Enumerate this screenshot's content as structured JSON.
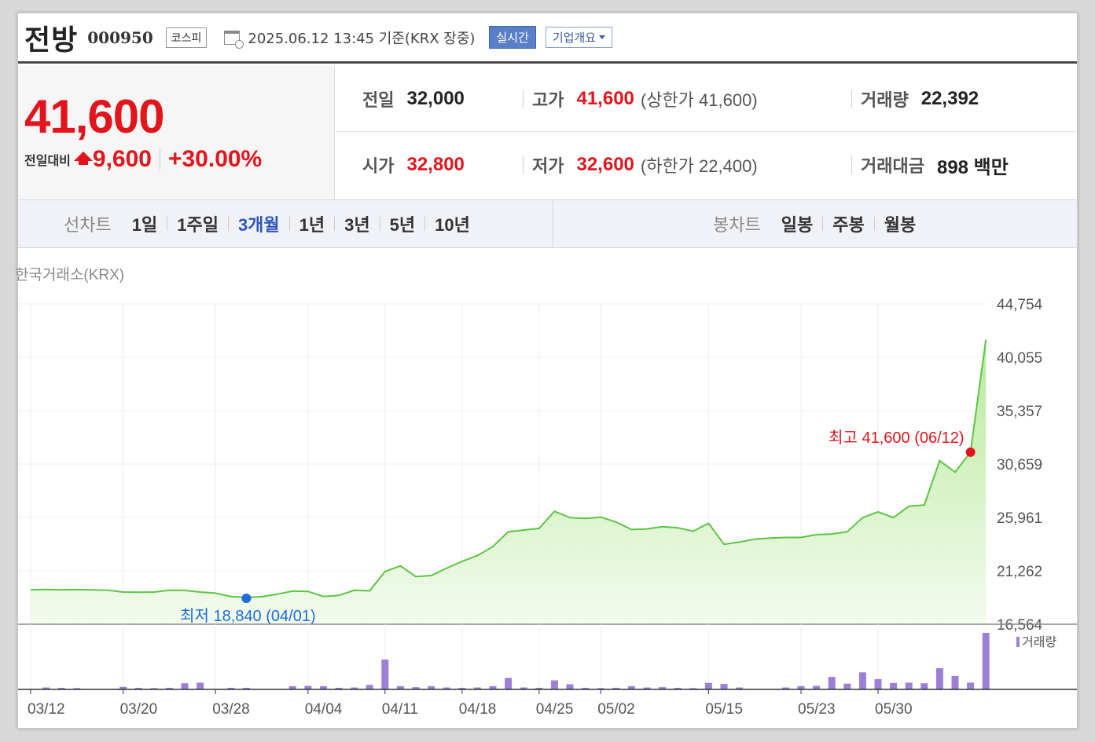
{
  "header": {
    "name": "전방",
    "code": "000950",
    "market": "코스피",
    "timestamp": "2025.06.12 13:45  기준(KRX 장중)",
    "realtime_label": "실시간",
    "company_label": "기업개요"
  },
  "price": {
    "current": "41,600",
    "change_label": "전일대비",
    "change": "9,600",
    "change_pct": "+30.00%"
  },
  "stats": {
    "prev_label": "전일",
    "prev": "32,000",
    "high_label": "고가",
    "high": "41,600",
    "high_note": "(상한가 41,600)",
    "volume_label": "거래량",
    "volume": "22,392",
    "open_label": "시가",
    "open": "32,800",
    "low_label": "저가",
    "low": "32,600",
    "low_note": "(하한가 22,400)",
    "amount_label": "거래대금",
    "amount": "898 백만"
  },
  "period": {
    "line_label": "선차트",
    "line_items": [
      "1일",
      "1주일",
      "3개월",
      "1년",
      "3년",
      "5년",
      "10년"
    ],
    "selected": "3개월",
    "candle_label": "봉차트",
    "candle_items": [
      "일봉",
      "주봉",
      "월봉"
    ]
  },
  "chart_data": {
    "type": "area",
    "source": "한국거래소(KRX)",
    "y_ticks": [
      "44,754",
      "40,055",
      "35,357",
      "30,659",
      "25,961",
      "21,262",
      "16,564"
    ],
    "y_tick_values": [
      44754,
      40055,
      35357,
      30659,
      25961,
      21262,
      16564
    ],
    "ylim": [
      16564,
      44754
    ],
    "x_ticks": [
      "03/12",
      "03/20",
      "03/28",
      "04/04",
      "04/11",
      "04/18",
      "04/25",
      "05/02",
      "05/15",
      "05/23",
      "05/30"
    ],
    "x_tick_index": [
      0,
      6,
      12,
      18,
      23,
      28,
      33,
      37,
      44,
      50,
      55
    ],
    "grid": true,
    "colors": {
      "line": "#5cc542",
      "fill_top": "#b9ea9e",
      "fill_bottom": "#f3fbee",
      "max": "#e2141c",
      "min": "#1a6fd8",
      "volume": "#9b80d6"
    },
    "max_label": "최고 41,600 (06/12)",
    "min_label": "최저 18,840 (04/01)",
    "max_index": 61,
    "min_index": 14,
    "price": [
      19600,
      19620,
      19600,
      19610,
      19580,
      19560,
      19400,
      19380,
      19400,
      19550,
      19540,
      19400,
      19300,
      19000,
      18920,
      18990,
      19200,
      19480,
      19450,
      19000,
      19100,
      19550,
      19500,
      21200,
      21700,
      20750,
      20850,
      21500,
      22100,
      22600,
      23400,
      24700,
      24850,
      25000,
      26500,
      25950,
      25880,
      25990,
      25550,
      24900,
      24950,
      25150,
      25050,
      24750,
      25450,
      23600,
      23800,
      24050,
      24150,
      24200,
      24200,
      24450,
      24500,
      24700,
      25950,
      26450,
      25950,
      26950,
      27050,
      30950,
      29950,
      31700,
      41600
    ],
    "volume_legend": "거래량",
    "volume": [
      0,
      0.6,
      0.5,
      0.4,
      0,
      0,
      0.8,
      0.5,
      0.4,
      0.5,
      1.9,
      2.1,
      0,
      0.5,
      0.5,
      0,
      0,
      1.0,
      1.1,
      1.0,
      0.5,
      0.6,
      1.4,
      9.3,
      1.0,
      0.7,
      1.0,
      0.6,
      0.5,
      0.6,
      1.0,
      3.6,
      0.6,
      0.5,
      2.8,
      1.6,
      0.5,
      0.4,
      0.5,
      1.0,
      0.6,
      0.7,
      0.5,
      0.4,
      2.0,
      1.7,
      0.6,
      0,
      0,
      0.6,
      1.0,
      1.1,
      3.9,
      1.8,
      5.3,
      3.2,
      2.0,
      2.1,
      1.9,
      6.6,
      4.2,
      2.1,
      17.6
    ]
  }
}
